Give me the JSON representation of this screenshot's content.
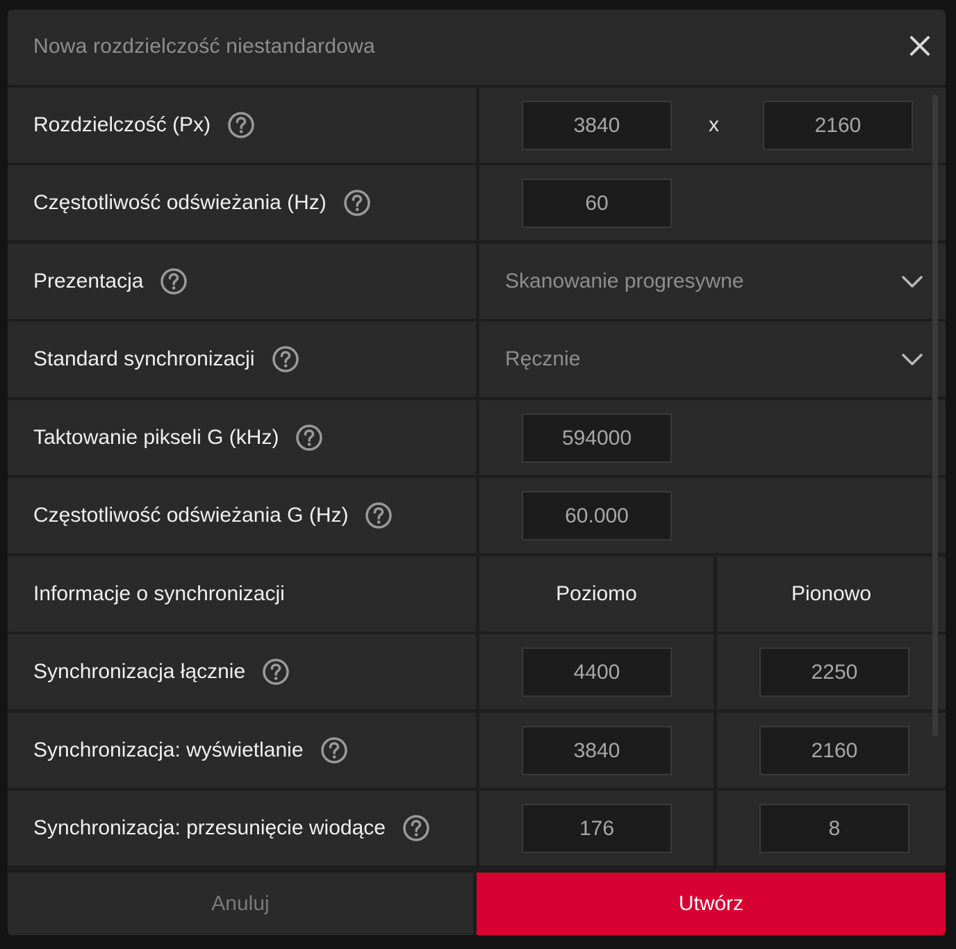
{
  "dialog": {
    "title": "Nowa rozdzielczość niestandardowa",
    "close_icon": "close-icon"
  },
  "resolution": {
    "label": "Rozdzielczość (Px)",
    "width": "3840",
    "separator": "x",
    "height": "2160"
  },
  "refresh_rate": {
    "label": "Częstotliwość odświeżania (Hz)",
    "value": "60"
  },
  "presentation": {
    "label": "Prezentacja",
    "selected": "Skanowanie progresywne"
  },
  "sync_standard": {
    "label": "Standard synchronizacji",
    "selected": "Ręcznie"
  },
  "pixel_clock": {
    "label": "Taktowanie pikseli G (kHz)",
    "value": "594000"
  },
  "g_refresh_rate": {
    "label": "Częstotliwość odświeżania G (Hz)",
    "value": "60.000"
  },
  "timing_info": {
    "label": "Informacje o synchronizacji",
    "horizontal_header": "Poziomo",
    "vertical_header": "Pionowo"
  },
  "timing_total": {
    "label": "Synchronizacja łącznie",
    "horizontal": "4400",
    "vertical": "2250"
  },
  "timing_display": {
    "label": "Synchronizacja: wyświetlanie",
    "horizontal": "3840",
    "vertical": "2160"
  },
  "timing_front_porch": {
    "label": "Synchronizacja: przesunięcie wiodące",
    "horizontal": "176",
    "vertical": "8"
  },
  "footer": {
    "cancel_label": "Anuluj",
    "create_label": "Utwórz"
  },
  "colors": {
    "accent": "#d70031",
    "background": "#2a2a2a",
    "text": "#f0f0f0",
    "muted_text": "#8e8e8e"
  }
}
